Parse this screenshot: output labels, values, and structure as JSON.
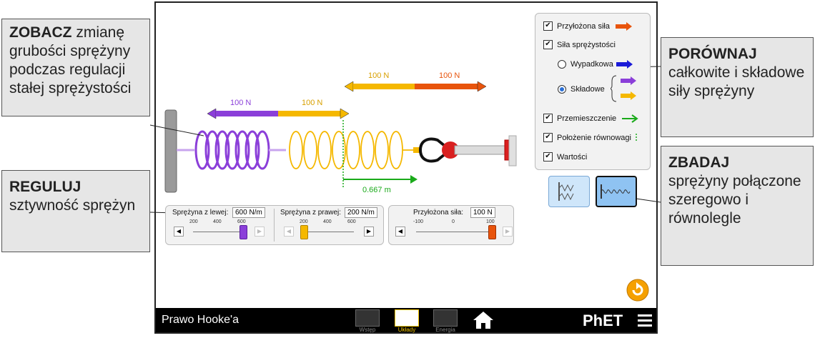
{
  "callouts": {
    "zobacz": {
      "head": "ZOBACZ",
      "rest": " zmianę grubości sprężyny podczas regulacji stałej sprężystości"
    },
    "reguluj": {
      "head": "REGULUJ",
      "rest": "sztywność sprężyn"
    },
    "porownaj": {
      "head": "PORÓWNAJ",
      "rest": "całkowite i składowe siły sprężyny"
    },
    "zbadaj": {
      "head": "ZBADAJ",
      "rest": "sprężyny połączone szeregowo i równolegle"
    }
  },
  "vectors": {
    "left_left": "100 N",
    "left_right": "100 N",
    "top_left": "100 N",
    "top_right": "100 N",
    "displacement": "0.667 m"
  },
  "checkbox_panel": {
    "applied_force": "Przyłożona siła",
    "spring_force": "Siła sprężystości",
    "total": "Wypadkowa",
    "components": "Składowe",
    "displacement": "Przemieszczenie",
    "equilibrium": "Położenie równowagi",
    "values": "Wartości"
  },
  "controls": {
    "left_spring": {
      "label": "Sprężyna z lewej:",
      "value": "600 N/m",
      "ticks": [
        "200",
        "400",
        "600"
      ],
      "level": 1.0
    },
    "right_spring": {
      "label": "Sprężyna z prawej:",
      "value": "200 N/m",
      "ticks": [
        "200",
        "400",
        "600"
      ],
      "level": 0.0
    },
    "applied_force": {
      "label": "Przyłożona siła:",
      "value": "100 N",
      "ticks": [
        "-100",
        "0",
        "100"
      ],
      "level": 1.0
    }
  },
  "navbar": {
    "title": "Prawo Hooke'a",
    "screens": [
      "Wstęp",
      "Układy",
      "Energia"
    ],
    "brand": "PhET"
  },
  "colors": {
    "purple": "#8b3fd9",
    "orange": "#f5a800",
    "red_orange": "#e8540c",
    "green": "#1aaa1a",
    "blue": "#1a1ad8"
  }
}
